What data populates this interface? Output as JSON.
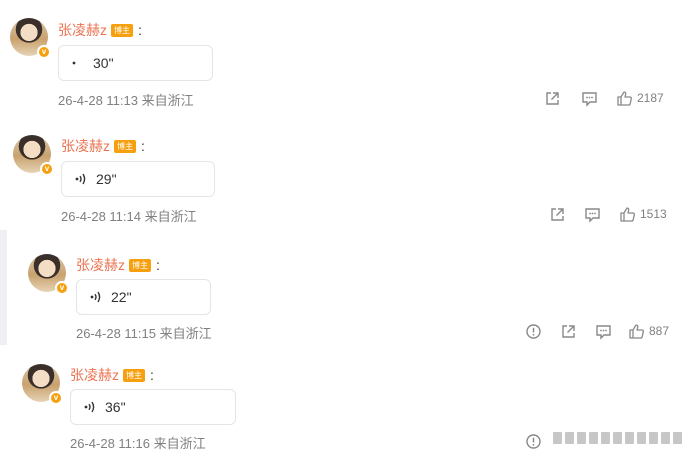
{
  "comments": [
    {
      "username": "张凌赫z",
      "role_badge": "博主",
      "colon": ":",
      "duration": "30\"",
      "timestamp": "26-4-28 11:13",
      "location": "来自浙江",
      "likes": "2187"
    },
    {
      "username": "张凌赫z",
      "role_badge": "博主",
      "colon": ":",
      "duration": "29\"",
      "timestamp": "26-4-28 11:14",
      "location": "来自浙江",
      "likes": "1513"
    },
    {
      "username": "张凌赫z",
      "role_badge": "博主",
      "colon": ":",
      "duration": "22\"",
      "timestamp": "26-4-28 11:15",
      "location": "来自浙江",
      "likes": "887"
    },
    {
      "username": "张凌赫z",
      "role_badge": "博主",
      "colon": ":",
      "duration": "36\"",
      "timestamp": "26-4-28 11:16",
      "location": "来自浙江",
      "likes": ""
    }
  ],
  "icons": {
    "voice": "sound-wave-icon",
    "share": "share-icon",
    "comment": "comment-icon",
    "like": "thumbs-up-icon",
    "report": "report-icon",
    "verified": "verified-badge-icon"
  },
  "colors": {
    "username": "#eb7350",
    "badge": "#f7a00f",
    "meta": "#808080"
  }
}
